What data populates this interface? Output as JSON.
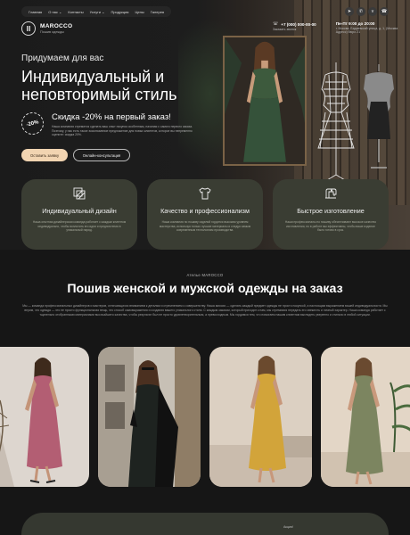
{
  "nav": {
    "links": [
      "Главная",
      "О нас",
      "Контакты",
      "Услуги",
      "Продукция",
      "Цены",
      "Галерея"
    ],
    "about_chevron": "⌄",
    "services_chevron": "⌄",
    "socials": [
      "telegram-icon",
      "whatsapp-icon",
      "vk-icon",
      "phone-icon"
    ]
  },
  "brand": {
    "name": "MAROCCO",
    "subtitle": "Пошив одежды",
    "icon_name": "column-icon"
  },
  "contacts": {
    "phone": "+7 (000) 000-00-00",
    "phone_note": "Заказать звонок",
    "hours": "Пн-Пт 9:00 до 20:00",
    "address": "г. Москва, Бадаевский улица, д. 1, (Москва Адресс) бюро 21"
  },
  "hero": {
    "eyebrow": "Придумаем для вас",
    "title": "Индивидуальный и неповторимый стиль",
    "badge": "-20%",
    "discount_title": "Скидка -20% на первый заказ!",
    "discount_text": "Наша компания стремится сделать ваш опыт покупок особенным, начиная с самого первого заказа. Поэтому, у нас есть такое эксклюзивное предложение для новых клиентов, которое вы непременно оцените: скидка 20%.",
    "btn_order": "Оставить заявку",
    "btn_consult": "Онлайн-консультация"
  },
  "features": [
    {
      "icon": "design-layers-icon",
      "title": "Индивидуальный дизайн",
      "text": "Наша опытная дизайнерская команда работает с каждым клиентом индивидуально, чтобы воплотить его идеи и предпочтения в уникальный наряд."
    },
    {
      "icon": "tshirt-icon",
      "title": "Качество и профессионализм",
      "text": "Наша компания по пошиву изделий гордится высоким уровнем мастерства, используя только лучшие материалы и следуя самым современным технологиям производства."
    },
    {
      "icon": "sewing-machine-icon",
      "title": "Быстрое изготовление",
      "text": "Наши профессионалы по пошиву обеспечивают высокое качество изготовления, но в работе мы эффективны, чтобы ваше изделие было готово в срок."
    }
  ],
  "about": {
    "eyebrow": "Ателье MAROCCO",
    "title": "Пошив женской и мужской одежды на заказ",
    "text": "Мы — команда профессиональных дизайнеров и мастеров, отличающихся вниманием к деталям и стремлением к совершенству. Наша миссия — сделать каждый предмет одежды не просто покупкой, а настоящим выражением вашей индивидуальности. Мы верим, что одежда — это не просто функциональная вещь, это способ самовыражения и создания вашего уникального стиля. С каждым заказом, который приходит к нам, мы стремимся передать его свежесть и личный характер. Наша команда работает с тщательно отобранными материалами высочайшего качества, чтобы результат был не просто удовлетворительным, а превосходным. Мы гордимся тем, что помогаем нашим клиентам выглядеть уверенно и стильно в любой ситуации."
  },
  "gallery": {
    "photos": [
      "rose-satin-dress-photo",
      "black-dress-street-photo",
      "mustard-silk-dress-photo",
      "olive-slip-dress-photo"
    ],
    "colors": {
      "rose": "#b35e73",
      "black": "#1e2320",
      "mustard": "#d2a43a",
      "olive": "#7c8560"
    }
  },
  "bottom": {
    "label": "Акция!"
  },
  "colors": {
    "background": "#161616",
    "card": "#3a3d33",
    "accent": "#f1d4b1"
  }
}
